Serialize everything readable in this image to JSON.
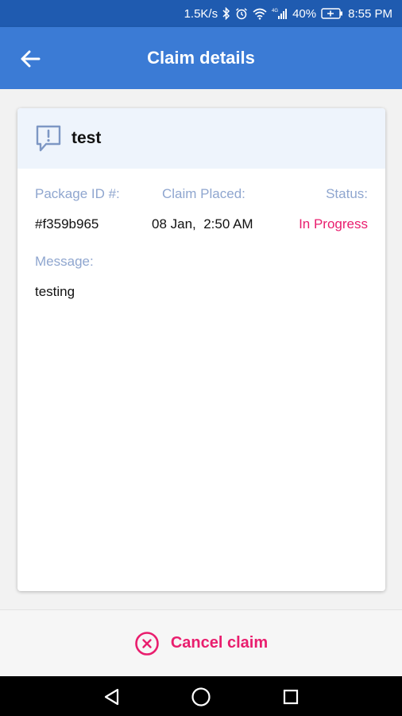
{
  "status_bar": {
    "speed": "1.5K/s",
    "battery": "40%",
    "time": "8:55 PM",
    "icons": [
      "bluetooth-icon",
      "alarm-icon",
      "wifi-icon",
      "signal-icon",
      "battery-charging-icon"
    ]
  },
  "app_bar": {
    "title": "Claim details",
    "back_icon": "arrow-left-icon"
  },
  "claim": {
    "title": "test",
    "icon": "message-alert-icon",
    "package_id_label": "Package ID #:",
    "package_id": "#f359b965",
    "claim_placed_label": "Claim Placed:",
    "claim_placed": "08 Jan,  2:50 AM",
    "status_label": "Status:",
    "status": "In Progress",
    "message_label": "Message:",
    "message": "testing"
  },
  "footer": {
    "cancel_label": "Cancel claim",
    "cancel_icon": "close-circle-icon"
  },
  "nav": {
    "icons": [
      "back-triangle-icon",
      "home-circle-icon",
      "recents-square-icon"
    ]
  },
  "colors": {
    "app_bar": "#3b7bd5",
    "status_bar": "#1f5bb0",
    "accent_pink": "#e91e6e",
    "label_blue": "#8fa6cf"
  }
}
